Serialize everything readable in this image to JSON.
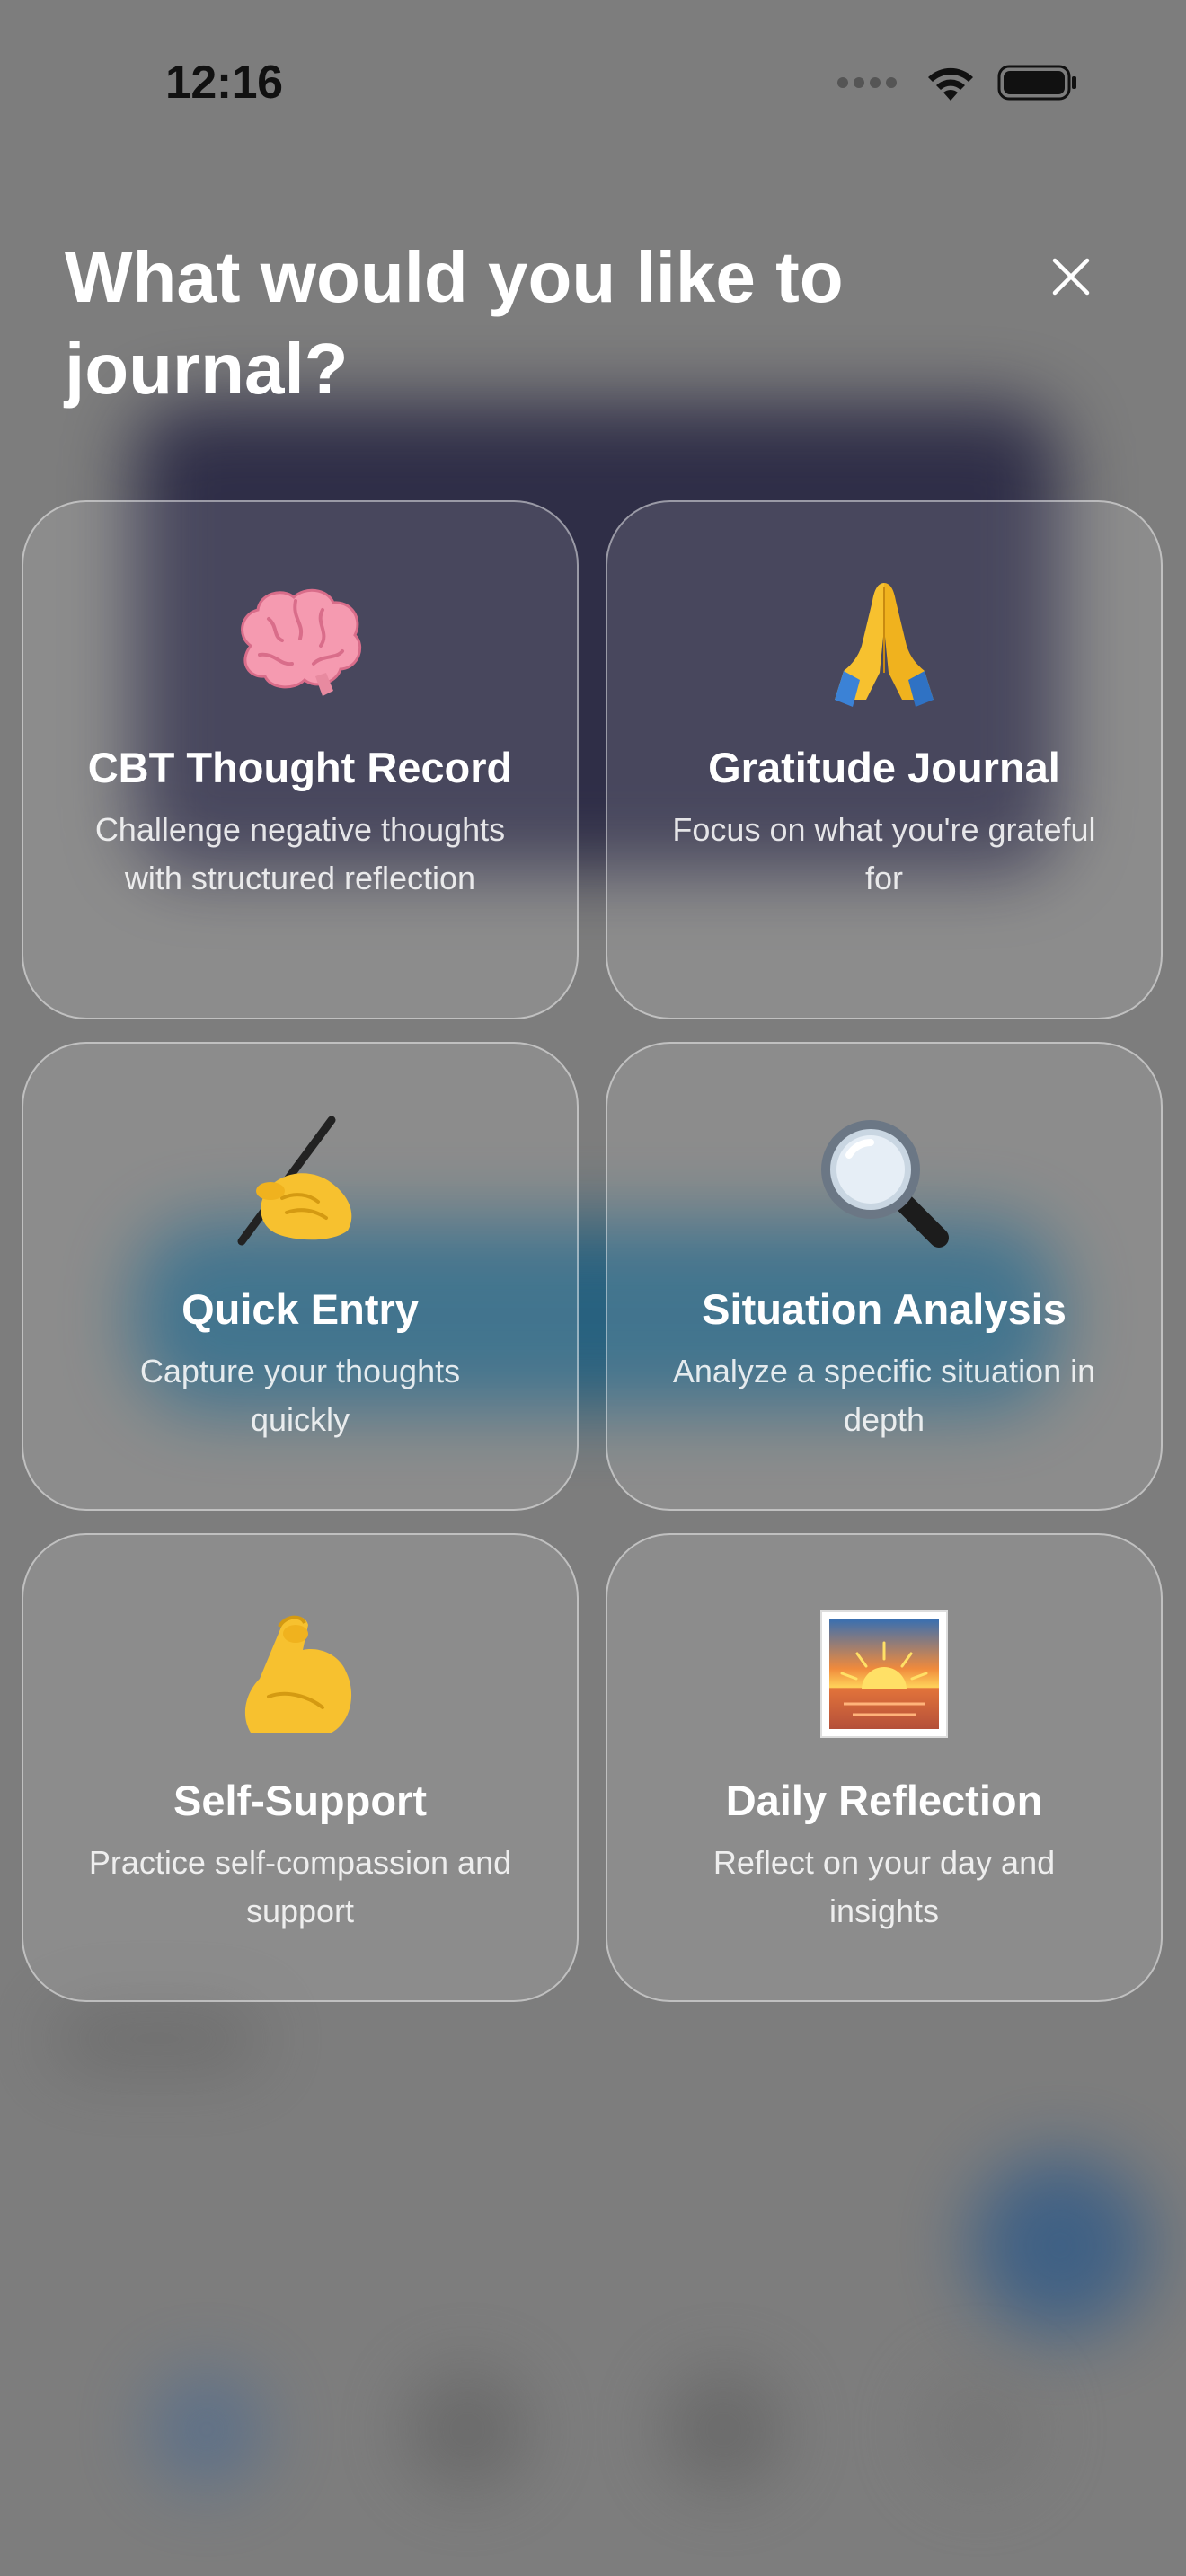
{
  "status_bar": {
    "time": "12:16"
  },
  "modal": {
    "title": "What would you like to journal?",
    "close_icon": "close-icon"
  },
  "cards": [
    {
      "id": "cbt",
      "icon": "brain-icon",
      "title": "CBT Thought Record",
      "description": "Challenge negative thoughts with structured reflection"
    },
    {
      "id": "gratitude",
      "icon": "folded-hands-icon",
      "title": "Gratitude Journal",
      "description": "Focus on what you're grateful for"
    },
    {
      "id": "quick",
      "icon": "writing-hand-icon",
      "title": "Quick Entry",
      "description": "Capture your thoughts quickly"
    },
    {
      "id": "situation",
      "icon": "magnifying-glass-icon",
      "title": "Situation Analysis",
      "description": "Analyze a specific situation in depth"
    },
    {
      "id": "self-support",
      "icon": "flexed-biceps-icon",
      "title": "Self-Support",
      "description": "Practice self-compassion and support"
    },
    {
      "id": "daily",
      "icon": "sunrise-icon",
      "title": "Daily Reflection",
      "description": "Reflect on your day and insights"
    }
  ]
}
